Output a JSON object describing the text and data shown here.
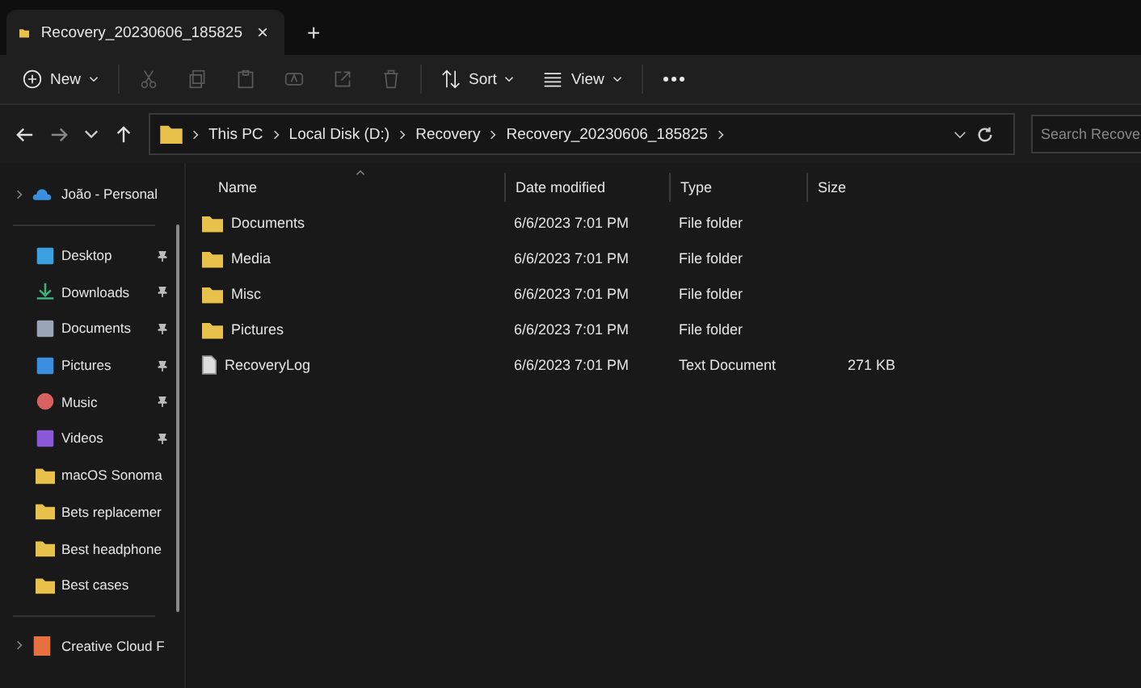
{
  "tab": {
    "title": "Recovery_20230606_185825",
    "close": "×",
    "new": "+"
  },
  "toolbar": [
    {
      "kind": "new",
      "label": "New",
      "disabled": false
    },
    {
      "kind": "cut",
      "disabled": true
    },
    {
      "kind": "copy",
      "disabled": true
    },
    {
      "kind": "paste",
      "disabled": true
    },
    {
      "kind": "rename",
      "disabled": true
    },
    {
      "kind": "share",
      "disabled": true
    },
    {
      "kind": "delete",
      "disabled": true
    },
    {
      "kind": "sort",
      "label": "Sort",
      "disabled": false
    },
    {
      "kind": "view",
      "label": "View",
      "disabled": false
    },
    {
      "kind": "more",
      "disabled": false
    }
  ],
  "breadcrumb": [
    "This PC",
    "Local Disk (D:)",
    "Recovery",
    "Recovery_20230606_185825"
  ],
  "search": {
    "placeholder": "Search Recove"
  },
  "sidebar": {
    "top": {
      "label": "João - Personal",
      "kind": "cloud"
    },
    "items": [
      {
        "label": "Desktop",
        "kind": "desktop",
        "pinned": true
      },
      {
        "label": "Downloads",
        "kind": "downloads",
        "pinned": true
      },
      {
        "label": "Documents",
        "kind": "documents",
        "pinned": true
      },
      {
        "label": "Pictures",
        "kind": "pictures",
        "pinned": true
      },
      {
        "label": "Music",
        "kind": "music",
        "pinned": true
      },
      {
        "label": "Videos",
        "kind": "videos",
        "pinned": true
      },
      {
        "label": "macOS Sonoma",
        "kind": "folder",
        "pinned": false
      },
      {
        "label": "Bets replacemer",
        "kind": "folder",
        "pinned": false
      },
      {
        "label": "Best headphone",
        "kind": "folder",
        "pinned": false
      },
      {
        "label": "Best cases",
        "kind": "folder",
        "pinned": false
      }
    ],
    "bottom": {
      "label": "Creative Cloud F",
      "kind": "app"
    }
  },
  "columns": [
    {
      "label": "Name",
      "sorted": true
    },
    {
      "label": "Date modified",
      "sorted": false
    },
    {
      "label": "Type",
      "sorted": false
    },
    {
      "label": "Size",
      "sorted": false
    }
  ],
  "files": [
    {
      "name": "Documents",
      "kind": "folder",
      "date": "6/6/2023 7:01 PM",
      "type": "File folder"
    },
    {
      "name": "Media",
      "kind": "folder",
      "date": "6/6/2023 7:01 PM",
      "type": "File folder"
    },
    {
      "name": "Misc",
      "kind": "folder",
      "date": "6/6/2023 7:01 PM",
      "type": "File folder"
    },
    {
      "name": "Pictures",
      "kind": "folder",
      "date": "6/6/2023 7:01 PM",
      "type": "File folder"
    },
    {
      "name": "RecoveryLog",
      "kind": "text",
      "date": "6/6/2023 7:01 PM",
      "type": "Text Document",
      "size": "271 KB"
    }
  ]
}
